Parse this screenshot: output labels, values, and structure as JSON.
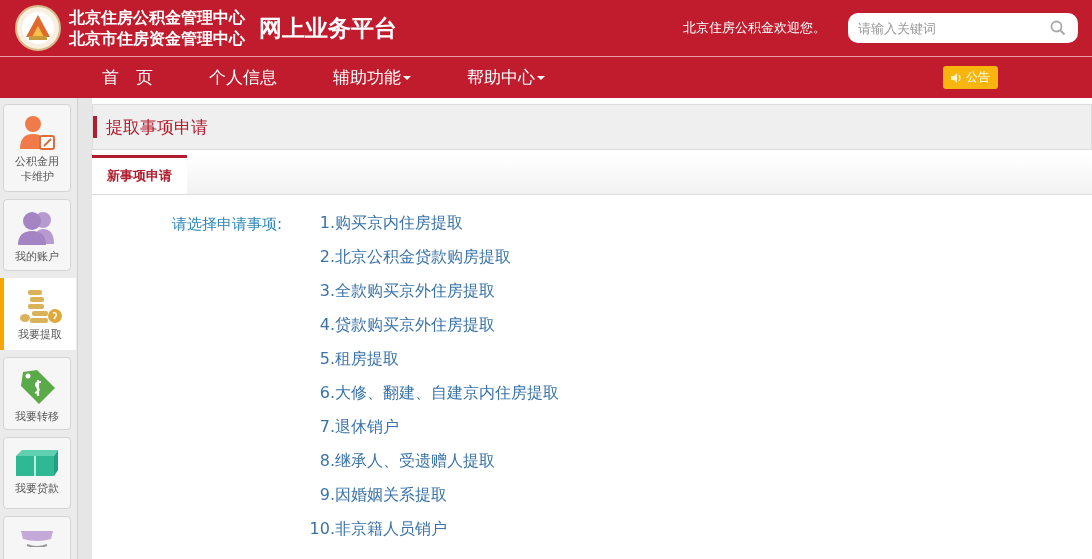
{
  "header": {
    "org_names": [
      "北京住房公积金管理中心",
      "北京市住房资金管理中心"
    ],
    "platform_title": "网上业务平台",
    "welcome": "北京住房公积金欢迎您。",
    "search": {
      "placeholder": "请输入关键词"
    }
  },
  "nav": {
    "items": [
      {
        "label": "首　页",
        "dropdown": false
      },
      {
        "label": "个人信息",
        "dropdown": false
      },
      {
        "label": "辅助功能",
        "dropdown": true
      },
      {
        "label": "帮助中心",
        "dropdown": true
      }
    ],
    "notice": "公告"
  },
  "sidebar": {
    "items": [
      {
        "label": "公积金用卡维护",
        "kind": "edit",
        "selected": false
      },
      {
        "label": "我的账户",
        "kind": "people",
        "selected": false
      },
      {
        "label": "我要提取",
        "kind": "coins",
        "selected": true
      },
      {
        "label": "我要转移",
        "kind": "tag",
        "selected": false
      },
      {
        "label": "我要贷款",
        "kind": "bills",
        "selected": false
      },
      {
        "kind": "store",
        "selected": false
      }
    ]
  },
  "page": {
    "title": "提取事项申请",
    "tabs": [
      {
        "label": "新事项申请",
        "selected": true
      }
    ],
    "prompt": "请选择申请事项:",
    "options": [
      {
        "number": "1.",
        "label": "购买京内住房提取"
      },
      {
        "number": "2.",
        "label": "北京公积金贷款购房提取"
      },
      {
        "number": "3.",
        "label": "全款购买京外住房提取"
      },
      {
        "number": "4.",
        "label": "贷款购买京外住房提取"
      },
      {
        "number": "5.",
        "label": "租房提取"
      },
      {
        "number": "6.",
        "label": "大修、翻建、自建京内住房提取"
      },
      {
        "number": "7.",
        "label": "退休销户"
      },
      {
        "number": "8.",
        "label": "继承人、受遗赠人提取"
      },
      {
        "number": "9.",
        "label": "因婚姻关系提取"
      },
      {
        "number": "10.",
        "label": "非京籍人员销户"
      }
    ]
  }
}
